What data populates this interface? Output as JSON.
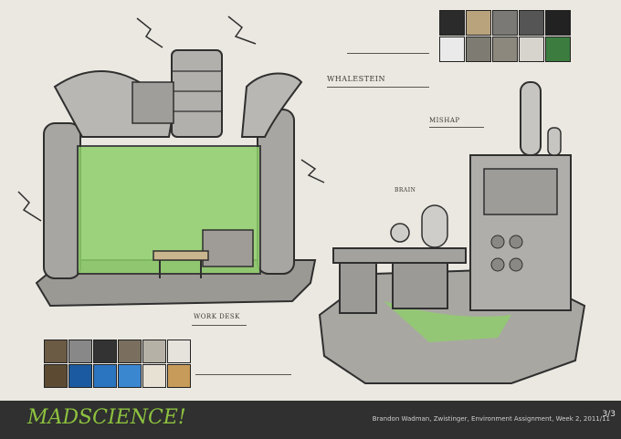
{
  "labels": {
    "whalestein": "WHALESTEIN",
    "mishap": "MISHAP",
    "work_desk": "WORK DESK",
    "brain": "BRAIN"
  },
  "footer": {
    "logo": "MADSCIENCE!",
    "credit": "Brandon Wadman, Zwistinger, Environment Assignment, Week 2, 2011/11",
    "page": "3/3"
  },
  "colors": {
    "paper": "#ebe8e1",
    "slime": "#8fcf6a",
    "footer_bg": "#2f302f",
    "logo_green": "#8dc23f"
  }
}
